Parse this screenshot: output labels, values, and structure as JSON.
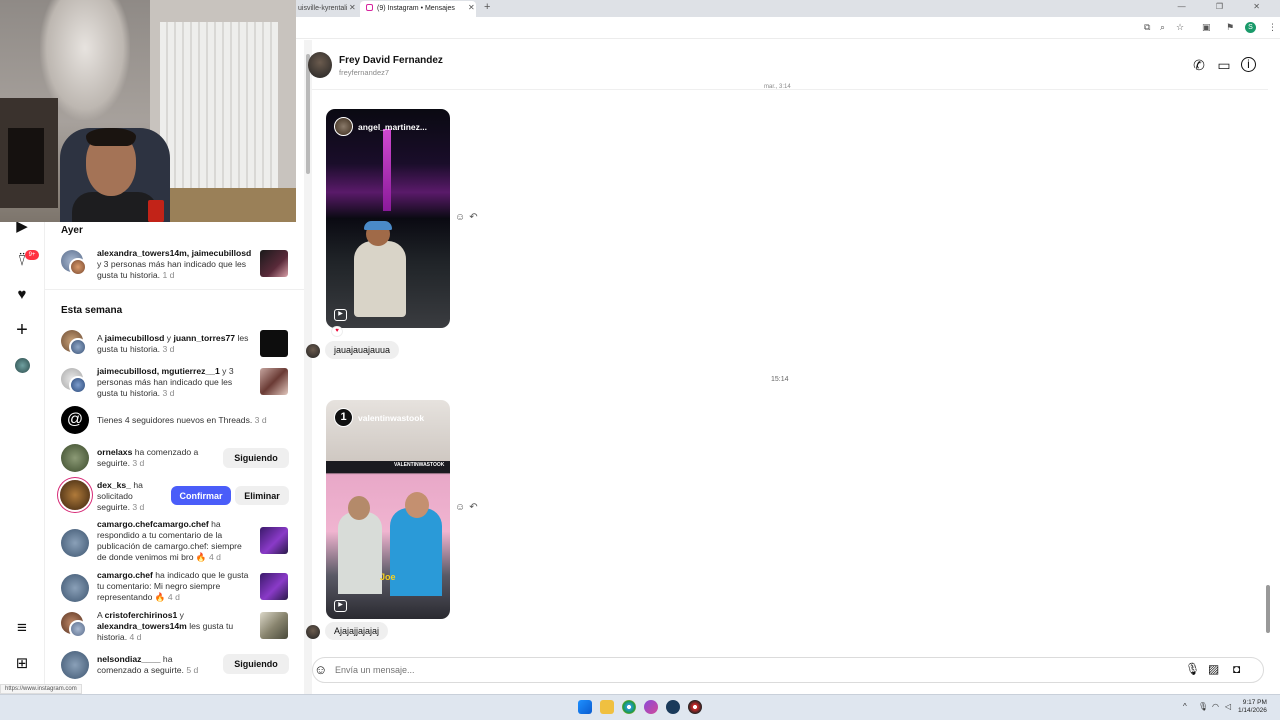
{
  "browser": {
    "tabs": [
      {
        "label": "uisville-kyrentali"
      },
      {
        "label": "(9) Instagram • Mensajes"
      }
    ],
    "new_tab_label": "+",
    "status_url": "https://www.instagram.com"
  },
  "rail": {
    "notifications_badge": "9+"
  },
  "notifications": {
    "sections": [
      {
        "title": "Ayer"
      },
      {
        "title": "Esta semana"
      }
    ],
    "items": [
      {
        "users": "alexandra_towers14m, jaimecubillosd",
        "text": " y 3 personas más han indicado que les gusta tu historia.",
        "time": " 1 d"
      },
      {
        "prefix": "A ",
        "users": "jaimecubillosd",
        "mid": " y ",
        "users2": "juann_torres77",
        "text": " les gusta tu historia.",
        "time": " 3 d"
      },
      {
        "users": "jaimecubillosd, mgutierrez__1",
        "text": " y 3 personas más han indicado que les gusta tu historia.",
        "time": " 3 d"
      },
      {
        "text": "Tienes 4 seguidores nuevos en Threads.",
        "time": " 3 d"
      },
      {
        "users": "ornelaxs",
        "text": " ha comenzado a seguirte.",
        "time": " 3 d",
        "button": "Siguiendo"
      },
      {
        "users": "dex_ks_",
        "text": " ha solicitado seguirte.",
        "time": " 3 d",
        "confirm": "Confirmar",
        "delete": "Eliminar"
      },
      {
        "users": "camargo.chefcamargo.chef",
        "text": " ha respondido a tu comentario de la publicación de camargo.chef: siempre de donde venimos mi bro 🔥",
        "time": " 4 d"
      },
      {
        "users": "camargo.chef",
        "text": " ha indicado que le gusta tu comentario: Mi negro siempre representando 🔥",
        "time": " 4 d"
      },
      {
        "prefix": "A ",
        "users": "cristoferchirinos1",
        "mid": " y ",
        "users2": "alexandra_towers14m",
        "text": " les gusta tu historia.",
        "time": " 4 d"
      },
      {
        "users": "nelsondiaz____",
        "text": " ha comenzado a seguirte.",
        "time": " 5 d",
        "button": "Siguiendo"
      }
    ]
  },
  "chat": {
    "contact_name": "Frey David Fernandez",
    "contact_username": "freyfernandez7",
    "timestamp_top": "mar., 3:14",
    "timestamp_mid": "15:14",
    "messages": [
      {
        "story_user": "angel_martinez...",
        "reply": "jauajauajauua"
      },
      {
        "story_user": "valentinwastook",
        "story_number": "1",
        "reply": "Ajajajjajajaj"
      }
    ],
    "composer_placeholder": "Envía un mensaje..."
  },
  "taskbar": {
    "clock_time": "9:17 PM",
    "clock_date": "1/14/2026"
  },
  "colors": {
    "accent_blue": "#4a5df9",
    "badge_red": "#ff3040"
  }
}
